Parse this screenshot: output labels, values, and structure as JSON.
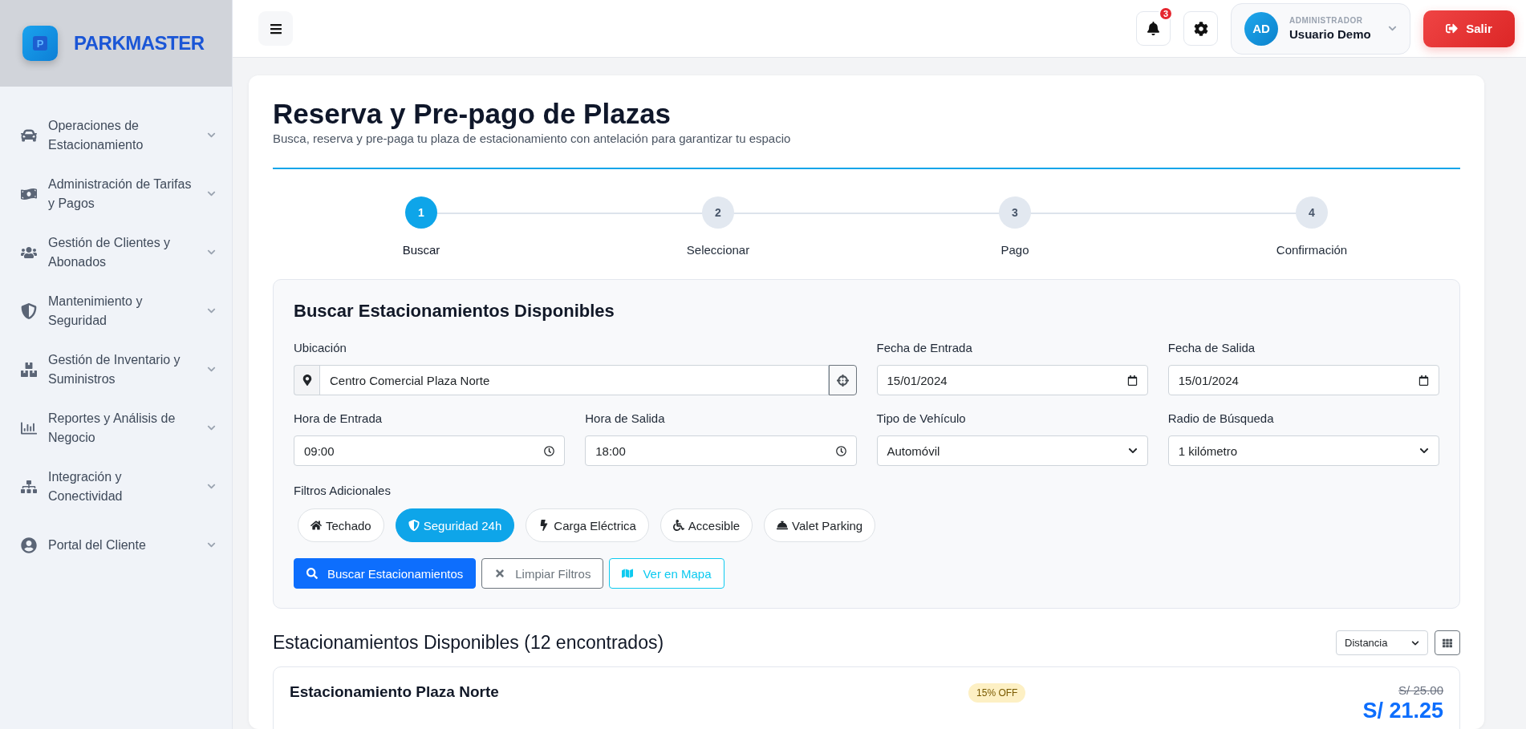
{
  "brand": {
    "logo_letter": "P",
    "name": "PARKMASTER"
  },
  "sidebar": {
    "items": [
      {
        "label": "Operaciones de Estacionamiento",
        "expanded": false
      },
      {
        "label": "Administración de Tarifas y Pagos",
        "expanded": false
      },
      {
        "label": "Gestión de Clientes y Abonados",
        "expanded": false
      },
      {
        "label": "Mantenimiento y Seguridad",
        "expanded": false
      },
      {
        "label": "Gestión de Inventario y Suministros",
        "expanded": false
      },
      {
        "label": "Reportes y Análisis de Negocio",
        "expanded": false
      },
      {
        "label": "Integración y Conectividad",
        "expanded": false
      },
      {
        "label": "Portal del Cliente",
        "expanded": false
      }
    ]
  },
  "topbar": {
    "notification_count": "3",
    "user": {
      "initials": "AD",
      "role": "ADMINISTRADOR",
      "name": "Usuario Demo"
    },
    "logout": "Salir"
  },
  "page": {
    "title": "Reserva y Pre-pago de Plazas",
    "subtitle": "Busca, reserva y pre-paga tu plaza de estacionamiento con antelación para garantizar tu espacio"
  },
  "steps": [
    {
      "number": "1",
      "label": "Buscar",
      "selected": true
    },
    {
      "number": "2",
      "label": "Seleccionar",
      "selected": false
    },
    {
      "number": "3",
      "label": "Pago",
      "selected": false
    },
    {
      "number": "4",
      "label": "Confirmación",
      "selected": false
    }
  ],
  "search": {
    "title": "Buscar Estacionamientos Disponibles",
    "fields": [
      {
        "kind": "location",
        "label": "Ubicación",
        "value": "Centro Comercial Plaza Norte"
      },
      {
        "kind": "date",
        "label": "Fecha de Entrada",
        "value": "15/01/2024"
      },
      {
        "kind": "date",
        "label": "Fecha de Salida",
        "value": "15/01/2024"
      },
      {
        "kind": "time",
        "label": "Hora de Entrada",
        "value": "09:00"
      },
      {
        "kind": "time",
        "label": "Hora de Salida",
        "value": "18:00"
      },
      {
        "kind": "select",
        "label": "Tipo de Vehículo",
        "value": "Automóvil"
      },
      {
        "kind": "select",
        "label": "Radio de Búsqueda",
        "value": "1 kilómetro"
      }
    ],
    "filters_label": "Filtros Adicionales",
    "filters": [
      {
        "label": "Techado",
        "selected": false
      },
      {
        "label": "Seguridad 24h",
        "selected": true
      },
      {
        "label": "Carga Eléctrica",
        "selected": false
      },
      {
        "label": "Accesible",
        "selected": false
      },
      {
        "label": "Valet Parking",
        "selected": false
      }
    ],
    "actions": [
      {
        "kind": "primary",
        "label": "Buscar Estacionamientos"
      },
      {
        "kind": "secondary",
        "label": "Limpiar Filtros"
      },
      {
        "kind": "map",
        "label": "Ver en Mapa"
      }
    ]
  },
  "results": {
    "title": "Estacionamientos Disponibles (12 encontrados)",
    "sort": "Distancia",
    "items": [
      {
        "name": "Estacionamiento Plaza Norte",
        "discount": "15% OFF",
        "old_price": "S/ 25.00",
        "price": "S/ 21.25"
      }
    ]
  }
}
